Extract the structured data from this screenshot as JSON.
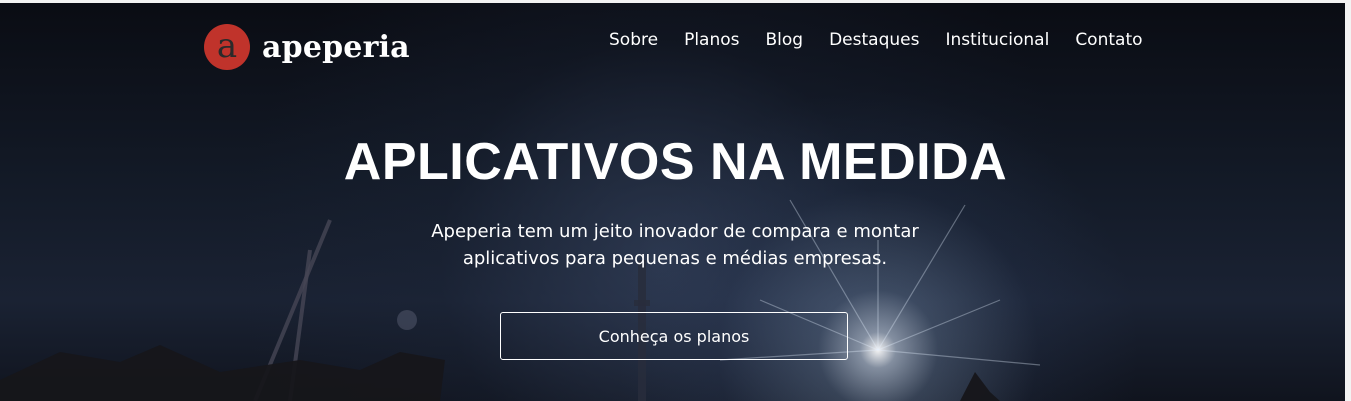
{
  "brand": {
    "logo_letter": "a",
    "name": "apeperia",
    "accent_color": "#c0332b"
  },
  "nav": {
    "items": [
      {
        "label": "Sobre"
      },
      {
        "label": "Planos"
      },
      {
        "label": "Blog"
      },
      {
        "label": "Destaques"
      },
      {
        "label": "Institucional"
      },
      {
        "label": "Contato"
      }
    ]
  },
  "hero": {
    "headline": "APLICATIVOS NA MEDIDA",
    "subtitle_line1": "Apeperia tem um jeito inovador de compara e montar",
    "subtitle_line2": "aplicativos para pequenas e médias empresas.",
    "cta_label": "Conheça os planos"
  }
}
